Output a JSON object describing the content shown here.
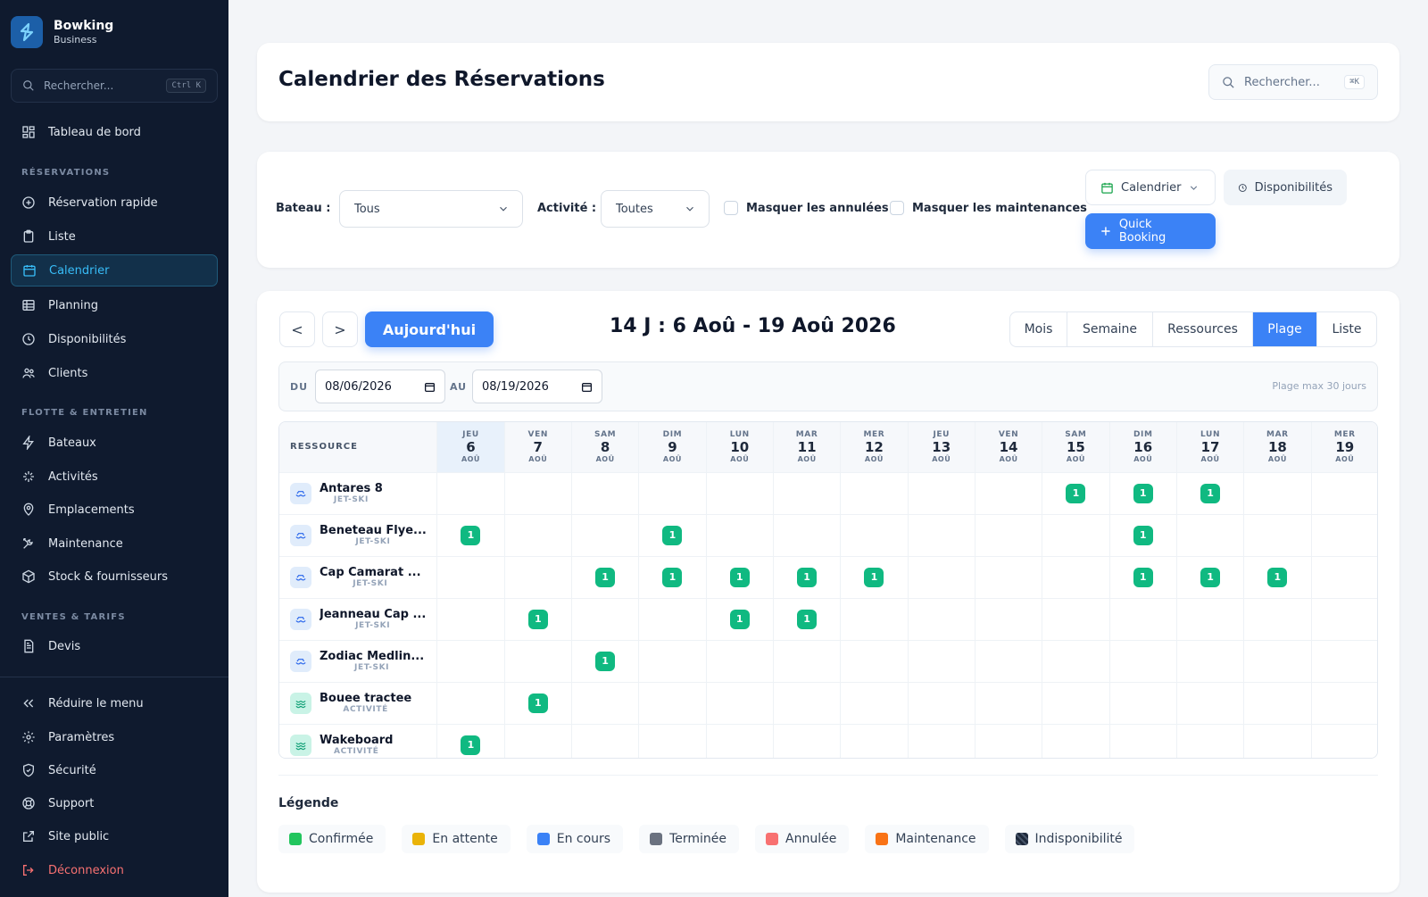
{
  "brand": {
    "name": "Bowking",
    "sub": "Business"
  },
  "sidebar": {
    "search_placeholder": "Rechercher...",
    "search_kbd": "Ctrl K",
    "top_item": "Tableau de bord",
    "sections": {
      "reservations": "RÉSERVATIONS",
      "flotte": "FLOTTE & ENTRETIEN",
      "ventes": "VENTES & TARIFS"
    },
    "items": {
      "rapide": "Réservation rapide",
      "liste": "Liste",
      "calendrier": "Calendrier",
      "planning": "Planning",
      "disponibilites": "Disponibilités",
      "clients": "Clients",
      "bateaux": "Bateaux",
      "activites": "Activités",
      "emplacements": "Emplacements",
      "maintenance": "Maintenance",
      "stock": "Stock & fournisseurs",
      "devis": "Devis"
    },
    "bottom": {
      "reduire": "Réduire le menu",
      "parametres": "Paramètres",
      "securite": "Sécurité",
      "support": "Support",
      "site": "Site public",
      "deconnexion": "Déconnexion"
    }
  },
  "header": {
    "title": "Calendrier des Réservations",
    "search_placeholder": "Rechercher...",
    "search_kbd": "⌘K"
  },
  "filters": {
    "bateau_label": "Bateau :",
    "bateau_value": "Tous",
    "activite_label": "Activité :",
    "activite_value": "Toutes",
    "hide_cancelled": "Masquer les annulées",
    "hide_maintenance": "Masquer les maintenances",
    "calendar_btn": "Calendrier",
    "dispo_btn": "Disponibilités",
    "quick_btn": "Quick Booking"
  },
  "calendar": {
    "prev": "<",
    "next": ">",
    "today": "Aujourd'hui",
    "range_title": "14 J : 6 Aoû - 19 Aoû 2026",
    "views": [
      "Mois",
      "Semaine",
      "Ressources",
      "Plage",
      "Liste"
    ],
    "active_view": "Plage",
    "du_label": "DU",
    "au_label": "AU",
    "from": "08/06/2026",
    "to": "08/19/2026",
    "max_note": "Plage max 30 jours",
    "resource_header": "RESSOURCE",
    "days": [
      {
        "dow": "JEU",
        "num": "6",
        "mon": "AOÛ",
        "today": true
      },
      {
        "dow": "VEN",
        "num": "7",
        "mon": "AOÛ"
      },
      {
        "dow": "SAM",
        "num": "8",
        "mon": "AOÛ"
      },
      {
        "dow": "DIM",
        "num": "9",
        "mon": "AOÛ"
      },
      {
        "dow": "LUN",
        "num": "10",
        "mon": "AOÛ"
      },
      {
        "dow": "MAR",
        "num": "11",
        "mon": "AOÛ"
      },
      {
        "dow": "MER",
        "num": "12",
        "mon": "AOÛ"
      },
      {
        "dow": "JEU",
        "num": "13",
        "mon": "AOÛ"
      },
      {
        "dow": "VEN",
        "num": "14",
        "mon": "AOÛ"
      },
      {
        "dow": "SAM",
        "num": "15",
        "mon": "AOÛ"
      },
      {
        "dow": "DIM",
        "num": "16",
        "mon": "AOÛ"
      },
      {
        "dow": "LUN",
        "num": "17",
        "mon": "AOÛ"
      },
      {
        "dow": "MAR",
        "num": "18",
        "mon": "AOÛ"
      },
      {
        "dow": "MER",
        "num": "19",
        "mon": "AOÛ"
      }
    ],
    "resources": [
      {
        "name": "Antares 8",
        "type": "JET-SKI",
        "kind": "boat",
        "cells": [
          "",
          "",
          "",
          "",
          "",
          "",
          "",
          "",
          "",
          "1",
          "1",
          "1",
          "",
          ""
        ]
      },
      {
        "name": "Beneteau Flye...",
        "type": "JET-SKI",
        "kind": "boat",
        "cells": [
          "1",
          "",
          "",
          "1",
          "",
          "",
          "",
          "",
          "",
          "",
          "1",
          "",
          "",
          ""
        ]
      },
      {
        "name": "Cap Camarat ...",
        "type": "JET-SKI",
        "kind": "boat",
        "cells": [
          "",
          "",
          "1",
          "1",
          "1",
          "1",
          "1",
          "",
          "",
          "",
          "1",
          "1",
          "1",
          ""
        ]
      },
      {
        "name": "Jeanneau Cap ...",
        "type": "JET-SKI",
        "kind": "boat",
        "cells": [
          "",
          "1",
          "",
          "",
          "1",
          "1",
          "",
          "",
          "",
          "",
          "",
          "",
          "",
          ""
        ]
      },
      {
        "name": "Zodiac Medlin...",
        "type": "JET-SKI",
        "kind": "boat",
        "cells": [
          "",
          "",
          "1",
          "",
          "",
          "",
          "",
          "",
          "",
          "",
          "",
          "",
          "",
          ""
        ]
      },
      {
        "name": "Bouee tractee",
        "type": "ACTIVITÉ",
        "kind": "activity",
        "cells": [
          "",
          "1",
          "",
          "",
          "",
          "",
          "",
          "",
          "",
          "",
          "",
          "",
          "",
          ""
        ]
      },
      {
        "name": "Wakeboard",
        "type": "ACTIVITÉ",
        "kind": "activity",
        "cells": [
          "1",
          "",
          "",
          "",
          "",
          "",
          "",
          "",
          "",
          "",
          "",
          "",
          "",
          ""
        ]
      }
    ]
  },
  "legend": {
    "title": "Légende",
    "items": [
      {
        "label": "Confirmée",
        "color": "#22c55e"
      },
      {
        "label": "En attente",
        "color": "#eab308"
      },
      {
        "label": "En cours",
        "color": "#3b82f6"
      },
      {
        "label": "Terminée",
        "color": "#6b7280"
      },
      {
        "label": "Annulée",
        "color": "#f87171"
      },
      {
        "label": "Maintenance",
        "color": "#f97316"
      },
      {
        "label": "Indisponibilité",
        "color": "#1e293b"
      }
    ]
  }
}
